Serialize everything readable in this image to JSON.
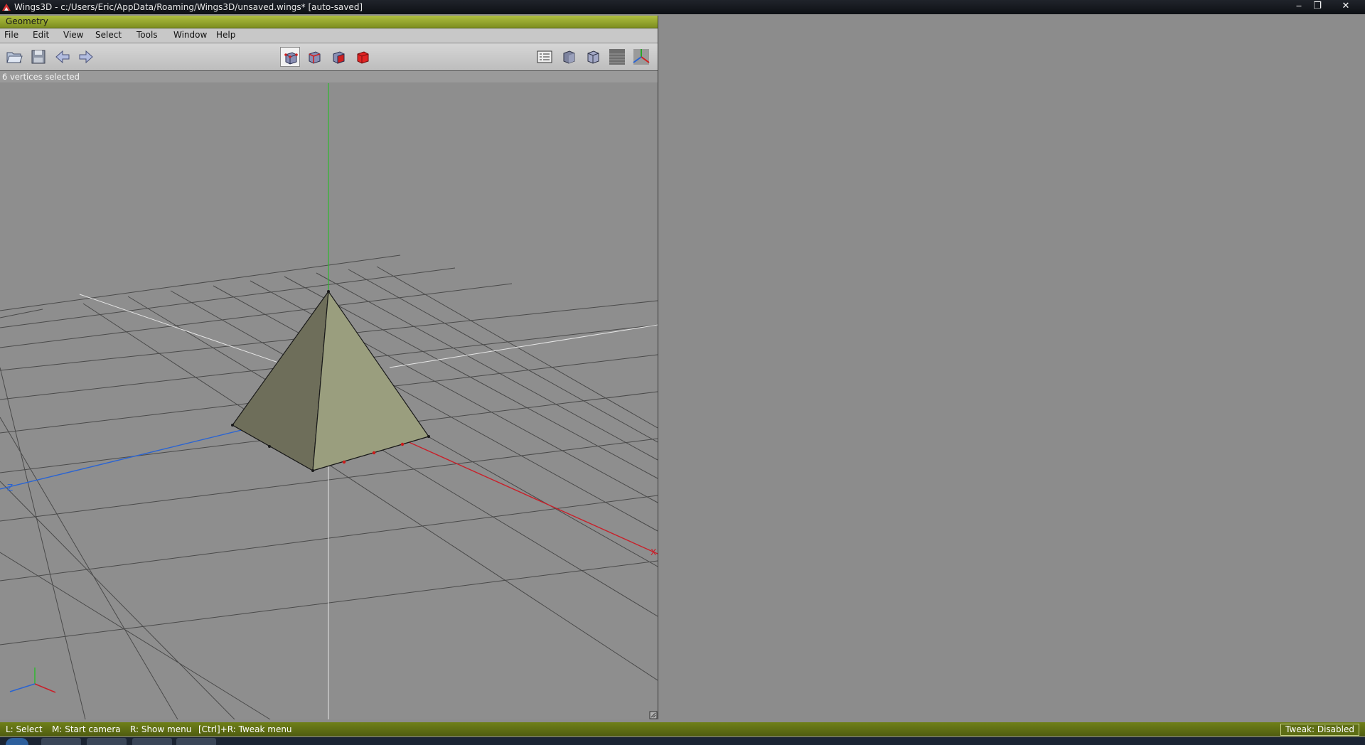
{
  "window": {
    "title": "Wings3D - c:/Users/Eric/AppData/Roaming/Wings3D/unsaved.wings* [auto-saved]",
    "controls": {
      "minimize": "‒",
      "restore": "❐",
      "close": "✕"
    }
  },
  "geometry": {
    "title": "Geometry",
    "menu": [
      "File",
      "Edit",
      "View",
      "Select",
      "Tools",
      "Window",
      "Help"
    ],
    "toolbar": {
      "left": [
        "open-icon",
        "save-icon",
        "undo-arrow-icon",
        "redo-arrow-icon"
      ],
      "selection_modes": [
        "vertex-mode-icon",
        "edge-mode-icon",
        "face-mode-icon",
        "body-mode-icon"
      ],
      "active_mode": "vertex-mode-icon",
      "right": [
        "workmode-list-icon",
        "smooth-shade-icon",
        "flat-shade-icon",
        "ground-plane-icon",
        "axes-icon"
      ]
    },
    "info": "6 vertices selected",
    "viewport": {
      "axis_labels": {
        "x": "X",
        "z": "Z"
      },
      "colors": {
        "x_axis": "#c8202a",
        "y_axis": "#2fb82f",
        "z_axis": "#2a64d2",
        "mesh_face_dark": "#6e6e5a",
        "mesh_face_light": "#9a9e7e",
        "selected_vertex": "#cc1a1a"
      }
    }
  },
  "status": {
    "hints": [
      "L: Select",
      "M: Start camera",
      "R: Show menu",
      "[Ctrl]+R: Tweak menu"
    ],
    "tweak": "Tweak: Disabled"
  },
  "colors": {
    "accent_bar": "#7d8e1f",
    "background": "#8c8c8c"
  }
}
